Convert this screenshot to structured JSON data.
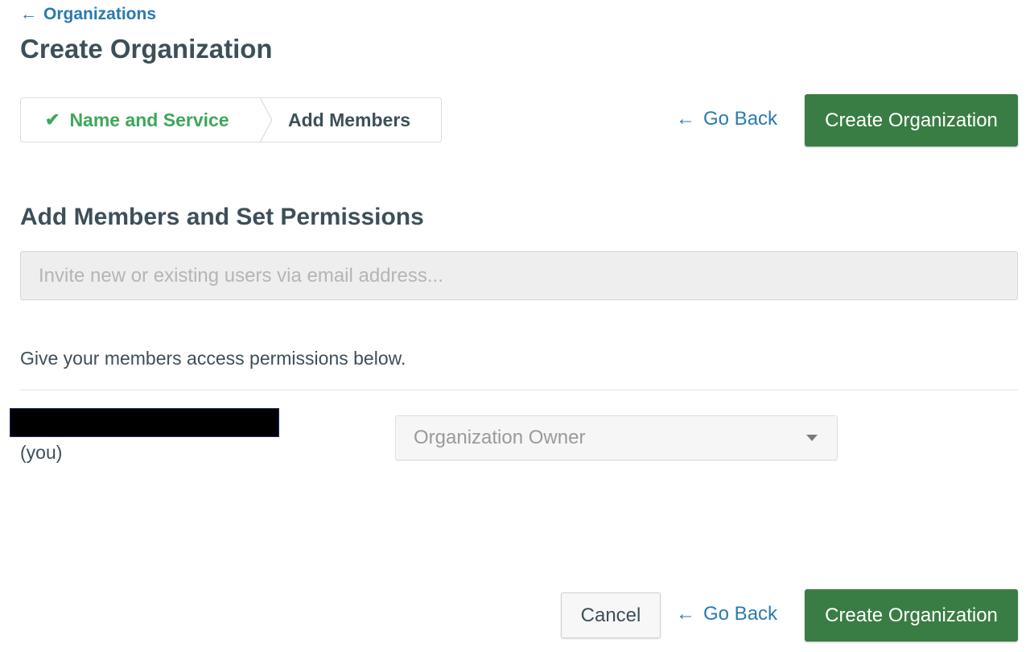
{
  "breadcrumb": {
    "label": "Organizations",
    "arrow_icon": "left-arrow-icon"
  },
  "page_title": "Create Organization",
  "steps": [
    {
      "label": "Name and Service",
      "status": "complete",
      "icon": "check-icon",
      "color": "#3ea75a"
    },
    {
      "label": "Add Members",
      "status": "current"
    }
  ],
  "header_actions": {
    "go_back_label": "Go Back",
    "create_label": "Create Organization"
  },
  "section": {
    "title": "Add Members and Set Permissions",
    "invite_placeholder": "Invite new or existing users via email address...",
    "invite_value": "",
    "hint": "Give your members access permissions below."
  },
  "members": [
    {
      "name_redacted": true,
      "you_label": "(you)",
      "role": "Organization Owner"
    }
  ],
  "footer_actions": {
    "cancel_label": "Cancel",
    "go_back_label": "Go Back",
    "create_label": "Create Organization"
  },
  "colors": {
    "link": "#2a7ab0",
    "primary": "#3a7d44",
    "success": "#3ea75a",
    "text": "#3d4f58"
  }
}
